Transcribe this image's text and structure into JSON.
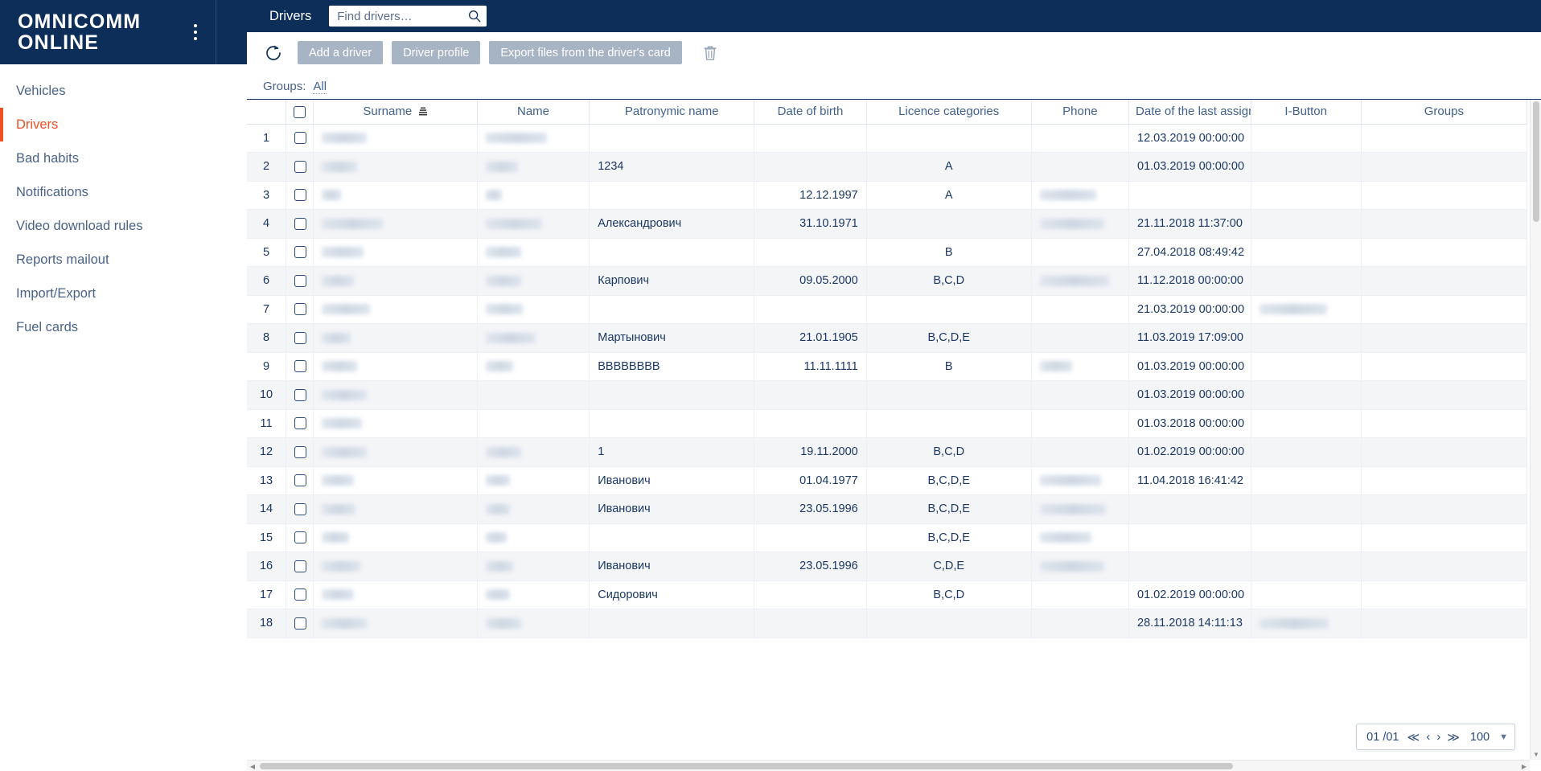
{
  "brand": {
    "line1": "OMNICOMM",
    "line2": "ONLINE",
    "kebab_icon": "kebab-menu-icon"
  },
  "sidebar": {
    "items": [
      {
        "label": "Vehicles",
        "active": false
      },
      {
        "label": "Drivers",
        "active": true
      },
      {
        "label": "Bad habits",
        "active": false
      },
      {
        "label": "Notifications",
        "active": false
      },
      {
        "label": "Video download rules",
        "active": false
      },
      {
        "label": "Reports mailout",
        "active": false
      },
      {
        "label": "Import/Export",
        "active": false
      },
      {
        "label": "Fuel cards",
        "active": false
      }
    ],
    "active_color": "#f04e23",
    "text_color": "#4a6287"
  },
  "topbar": {
    "title": "Drivers",
    "search": {
      "value": "",
      "placeholder": "Find drivers…",
      "icon": "search-icon"
    },
    "background": "#0d2e58"
  },
  "toolbar": {
    "refresh_icon": "refresh-icon",
    "buttons": [
      {
        "label": "Add a driver",
        "disabled": true
      },
      {
        "label": "Driver profile",
        "disabled": true
      },
      {
        "label": "Export files from the driver's card",
        "disabled": true
      }
    ],
    "delete_icon": "trash-icon",
    "button_color": "#a7b4c4"
  },
  "filters": {
    "groups_label": "Groups:",
    "groups_value": "All"
  },
  "table": {
    "select_all_checked": false,
    "sort_column": "Surname",
    "sort_icon": "sort-ascending-icon",
    "columns": [
      {
        "key": "num",
        "label": ""
      },
      {
        "key": "chk",
        "label": ""
      },
      {
        "key": "surname",
        "label": "Surname"
      },
      {
        "key": "name",
        "label": "Name"
      },
      {
        "key": "patronymic",
        "label": "Patronymic name"
      },
      {
        "key": "dob",
        "label": "Date of birth"
      },
      {
        "key": "licence",
        "label": "Licence categories"
      },
      {
        "key": "phone",
        "label": "Phone"
      },
      {
        "key": "last_assignment",
        "label": "Date of the last assignm"
      },
      {
        "key": "ibutton",
        "label": "I-Button"
      },
      {
        "key": "groups",
        "label": "Groups"
      }
    ],
    "rows": [
      {
        "num": "1",
        "surname_w": 56,
        "name_w": 76,
        "patronymic": "",
        "dob": "",
        "licence": "",
        "phone_w": 0,
        "last_assignment": "12.03.2019 00:00:00",
        "ibutton_w": 0,
        "groups": ""
      },
      {
        "num": "2",
        "surname_w": 44,
        "name_w": 40,
        "patronymic": "1234",
        "dob": "",
        "licence": "A",
        "phone_w": 0,
        "last_assignment": "01.03.2019 00:00:00",
        "ibutton_w": 0,
        "groups": ""
      },
      {
        "num": "3",
        "surname_w": 24,
        "name_w": 20,
        "patronymic": "",
        "dob": "12.12.1997",
        "licence": "A",
        "phone_w": 70,
        "last_assignment": "",
        "ibutton_w": 0,
        "groups": ""
      },
      {
        "num": "4",
        "surname_w": 76,
        "name_w": 70,
        "patronymic": "Александрович",
        "dob": "31.10.1971",
        "licence": "",
        "phone_w": 80,
        "last_assignment": "21.11.2018 11:37:00",
        "ibutton_w": 0,
        "groups": ""
      },
      {
        "num": "5",
        "surname_w": 52,
        "name_w": 44,
        "patronymic": "",
        "dob": "",
        "licence": "B",
        "phone_w": 0,
        "last_assignment": "27.04.2018 08:49:42",
        "ibutton_w": 0,
        "groups": ""
      },
      {
        "num": "6",
        "surname_w": 40,
        "name_w": 44,
        "patronymic": "Карпович",
        "dob": "09.05.2000",
        "licence": "B,C,D",
        "phone_w": 86,
        "last_assignment": "11.12.2018 00:00:00",
        "ibutton_w": 0,
        "groups": ""
      },
      {
        "num": "7",
        "surname_w": 60,
        "name_w": 46,
        "patronymic": "",
        "dob": "",
        "licence": "",
        "phone_w": 0,
        "last_assignment": "21.03.2019 00:00:00",
        "ibutton_w": 84,
        "groups": ""
      },
      {
        "num": "8",
        "surname_w": 36,
        "name_w": 62,
        "patronymic": "Мартынович",
        "dob": "21.01.1905",
        "licence": "B,C,D,E",
        "phone_w": 0,
        "last_assignment": "11.03.2019 17:09:00",
        "ibutton_w": 0,
        "groups": ""
      },
      {
        "num": "9",
        "surname_w": 44,
        "name_w": 34,
        "patronymic": "BBBBBBBB",
        "dob": "11.11.1111",
        "licence": "B",
        "phone_w": 40,
        "last_assignment": "01.03.2019 00:00:00",
        "ibutton_w": 0,
        "groups": ""
      },
      {
        "num": "10",
        "surname_w": 56,
        "name_w": 0,
        "patronymic": "",
        "dob": "",
        "licence": "",
        "phone_w": 0,
        "last_assignment": "01.03.2019 00:00:00",
        "ibutton_w": 0,
        "groups": ""
      },
      {
        "num": "11",
        "surname_w": 50,
        "name_w": 0,
        "patronymic": "",
        "dob": "",
        "licence": "",
        "phone_w": 0,
        "last_assignment": "01.03.2018 00:00:00",
        "ibutton_w": 0,
        "groups": ""
      },
      {
        "num": "12",
        "surname_w": 56,
        "name_w": 44,
        "patronymic": "1",
        "dob": "19.11.2000",
        "licence": "B,C,D",
        "phone_w": 0,
        "last_assignment": "01.02.2019 00:00:00",
        "ibutton_w": 0,
        "groups": ""
      },
      {
        "num": "13",
        "surname_w": 40,
        "name_w": 30,
        "patronymic": "Иванович",
        "dob": "01.04.1977",
        "licence": "B,C,D,E",
        "phone_w": 76,
        "last_assignment": "11.04.2018 16:41:42",
        "ibutton_w": 0,
        "groups": ""
      },
      {
        "num": "14",
        "surname_w": 42,
        "name_w": 30,
        "patronymic": "Иванович",
        "dob": "23.05.1996",
        "licence": "B,C,D,E",
        "phone_w": 82,
        "last_assignment": "",
        "ibutton_w": 0,
        "groups": ""
      },
      {
        "num": "15",
        "surname_w": 34,
        "name_w": 26,
        "patronymic": "",
        "dob": "",
        "licence": "B,C,D,E",
        "phone_w": 64,
        "last_assignment": "",
        "ibutton_w": 0,
        "groups": ""
      },
      {
        "num": "16",
        "surname_w": 48,
        "name_w": 34,
        "patronymic": "Иванович",
        "dob": "23.05.1996",
        "licence": "C,D,E",
        "phone_w": 80,
        "last_assignment": "",
        "ibutton_w": 0,
        "groups": ""
      },
      {
        "num": "17",
        "surname_w": 40,
        "name_w": 30,
        "patronymic": "Сидорович",
        "dob": "",
        "licence": "B,C,D",
        "phone_w": 0,
        "last_assignment": "01.02.2019 00:00:00",
        "ibutton_w": 0,
        "groups": ""
      },
      {
        "num": "18",
        "surname_w": 56,
        "name_w": 44,
        "patronymic": "",
        "dob": "",
        "licence": "",
        "phone_w": 0,
        "last_assignment": "28.11.2018 14:11:13",
        "ibutton_w": 86,
        "groups": ""
      }
    ]
  },
  "pagination": {
    "page_display": "01 /01",
    "first_icon": "≪",
    "prev_icon": "‹",
    "next_icon": "›",
    "last_icon": "≫",
    "page_size": "100",
    "caret_icon": "chevron-down-icon"
  }
}
